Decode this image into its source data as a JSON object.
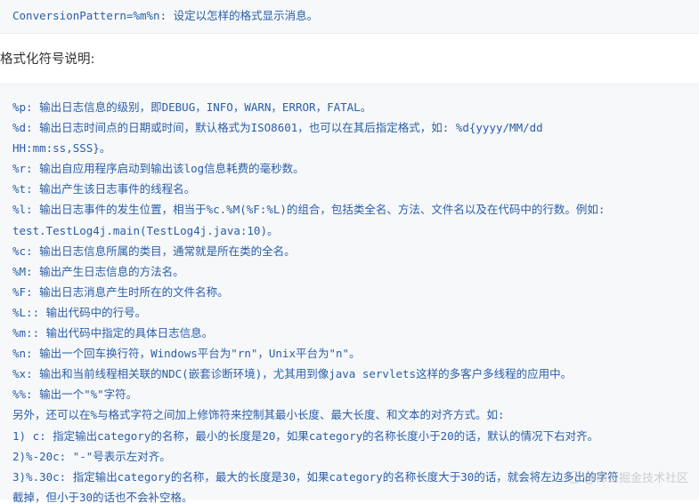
{
  "top_code": {
    "line": "ConversionPattern=%m%n: 设定以怎样的格式显示消息。"
  },
  "heading": "格式化符号说明:",
  "code_lines": [
    "%p: 输出日志信息的级别，即DEBUG，INFO，WARN，ERROR，FATAL。",
    "%d: 输出日志时间点的日期或时间，默认格式为ISO8601，也可以在其后指定格式，如: %d{yyyy/MM/dd",
    "HH:mm:ss,SSS}。",
    "%r: 输出自应用程序启动到输出该log信息耗费的毫秒数。",
    "%t: 输出产生该日志事件的线程名。",
    "%l: 输出日志事件的发生位置，相当于%c.%M(%F:%L)的组合，包括类全名、方法、文件名以及在代码中的行数。例如:",
    "test.TestLog4j.main(TestLog4j.java:10)。",
    "%c: 输出日志信息所属的类目，通常就是所在类的全名。",
    "%M: 输出产生日志信息的方法名。",
    "%F: 输出日志消息产生时所在的文件名称。",
    "%L:: 输出代码中的行号。",
    "%m:: 输出代码中指定的具体日志信息。",
    "%n: 输出一个回车换行符，Windows平台为\"rn\"，Unix平台为\"n\"。",
    "%x: 输出和当前线程相关联的NDC(嵌套诊断环境)，尤其用到像java servlets这样的多客户多线程的应用中。",
    "%%: 输出一个\"%\"字符。",
    "另外，还可以在%与格式字符之间加上修饰符来控制其最小长度、最大长度、和文本的对齐方式。如:",
    "1) c: 指定输出category的名称，最小的长度是20，如果category的名称长度小于20的话，默认的情况下右对齐。",
    "2)%-20c: \"-\"号表示左对齐。",
    "3)%.30c: 指定输出category的名称，最大的长度是30，如果category的名称长度大于30的话，就会将左边多出的字符",
    "截掉，但小于30的话也不会补空格。"
  ],
  "watermark": "@稀土掘金技术社区",
  "colors": {
    "code_text": "#2b5ea8",
    "code_bg": "#f6f8fa",
    "heading_text": "#333333"
  }
}
